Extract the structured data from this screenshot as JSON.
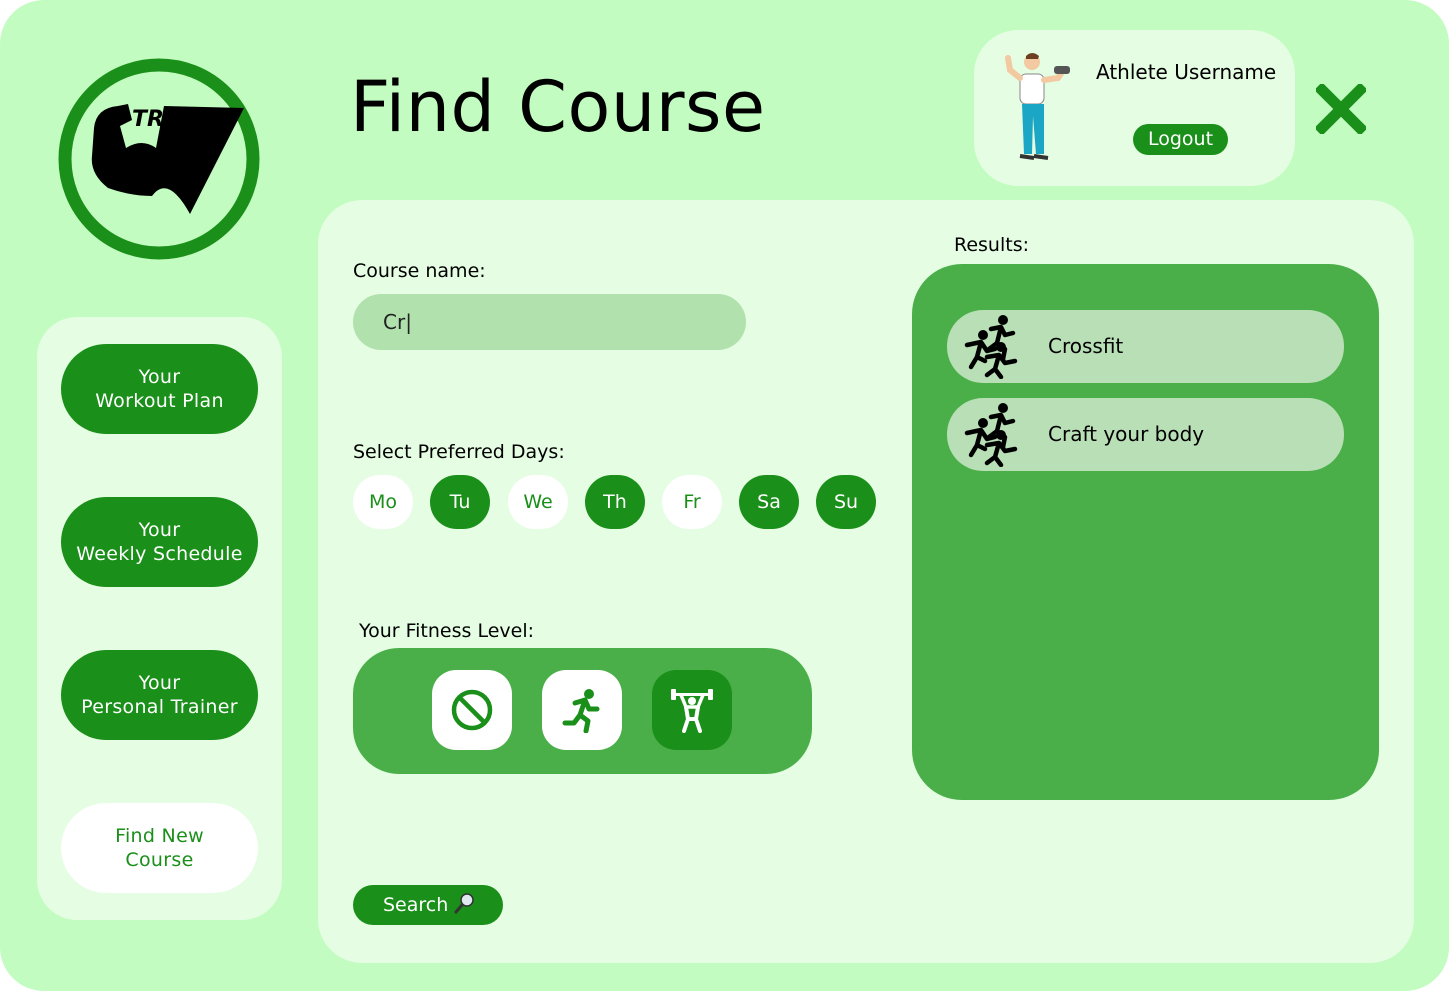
{
  "brand": {
    "logo_text": "TRAIN",
    "accent_color": "#1a8f19",
    "light_green": "#c2fcc0",
    "panel_green": "#4baf49"
  },
  "header": {
    "title": "Find Course"
  },
  "user": {
    "name": "Athlete Username",
    "logout_label": "Logout",
    "avatar_icon": "athlete-avatar-icon"
  },
  "sidebar": {
    "items": [
      {
        "line1": "Your",
        "line2": "Workout Plan",
        "active": false
      },
      {
        "line1": "Your",
        "line2": "Weekly Schedule",
        "active": false
      },
      {
        "line1": "Your",
        "line2": "Personal Trainer",
        "active": false
      },
      {
        "line1": "Find New",
        "line2": "Course",
        "active": true
      }
    ]
  },
  "form": {
    "course_name_label": "Course name:",
    "course_name_value": "Cr|",
    "days_label": "Select Preferred Days:",
    "days": [
      {
        "label": "Mo",
        "selected": false
      },
      {
        "label": "Tu",
        "selected": true
      },
      {
        "label": "We",
        "selected": false
      },
      {
        "label": "Th",
        "selected": true
      },
      {
        "label": "Fr",
        "selected": false
      },
      {
        "label": "Sa",
        "selected": true
      },
      {
        "label": "Su",
        "selected": true
      }
    ],
    "fitness_label": "Your Fitness Level:",
    "fitness_levels": [
      {
        "icon": "no-activity-icon",
        "selected": false
      },
      {
        "icon": "runner-icon",
        "selected": false
      },
      {
        "icon": "weightlifter-icon",
        "selected": true
      }
    ],
    "search_label": "Search",
    "search_icon": "magnifier-icon"
  },
  "results": {
    "label": "Results:",
    "items": [
      {
        "name": "Crossfit",
        "icon": "group-running-icon"
      },
      {
        "name": "Craft your body",
        "icon": "group-running-icon"
      }
    ]
  }
}
